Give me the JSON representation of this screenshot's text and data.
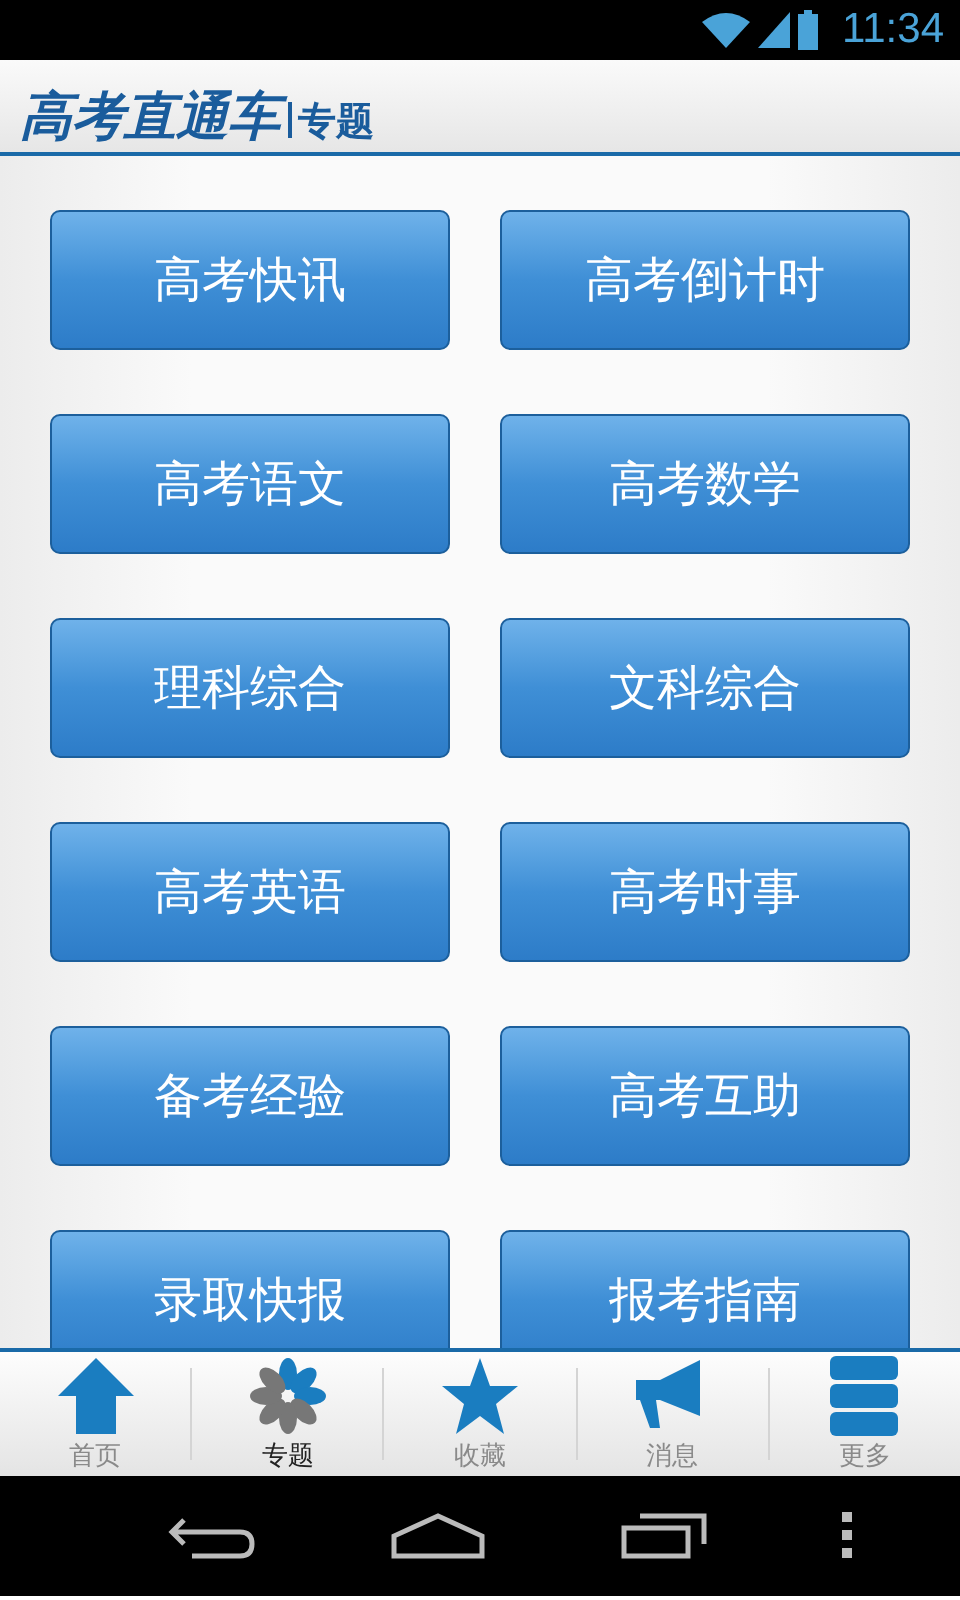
{
  "status_bar": {
    "time": "11:34"
  },
  "header": {
    "logo": "高考直通车",
    "section": "专题"
  },
  "topics": [
    "高考快讯",
    "高考倒计时",
    "高考语文",
    "高考数学",
    "理科综合",
    "文科综合",
    "高考英语",
    "高考时事",
    "备考经验",
    "高考互助",
    "录取快报",
    "报考指南"
  ],
  "tabs": [
    {
      "label": "首页",
      "selected": false
    },
    {
      "label": "专题",
      "selected": true
    },
    {
      "label": "收藏",
      "selected": false
    },
    {
      "label": "消息",
      "selected": false
    },
    {
      "label": "更多",
      "selected": false
    }
  ]
}
